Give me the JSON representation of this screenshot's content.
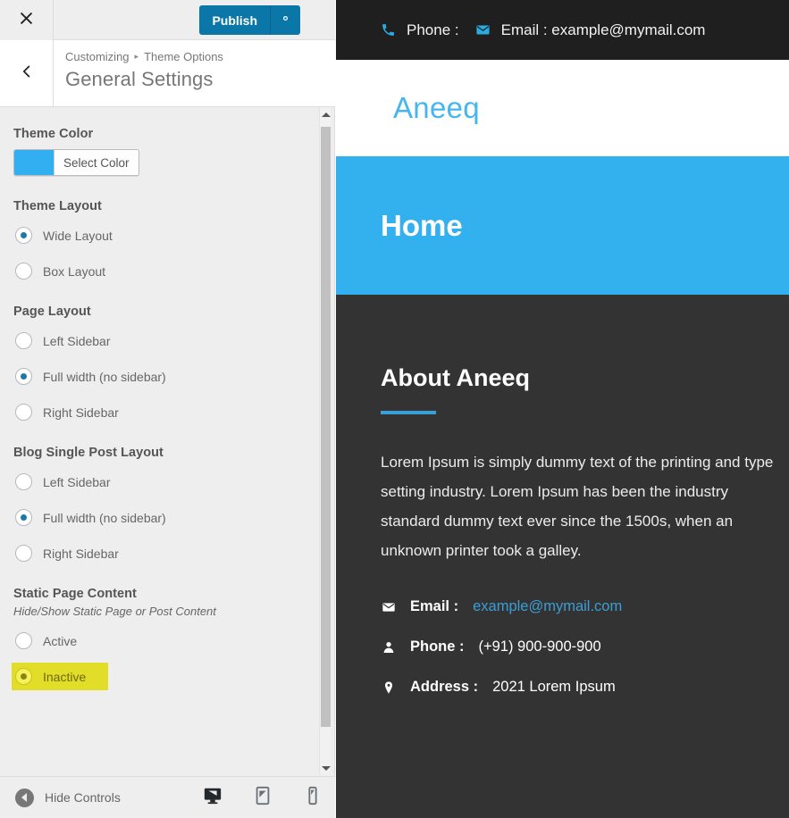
{
  "customizer": {
    "close_icon": "close-icon",
    "publish_label": "Publish",
    "gear_icon": "gear-icon",
    "back_icon": "chevron-left-icon",
    "breadcrumb_root": "Customizing",
    "breadcrumb_sep": "▸",
    "breadcrumb_parent": "Theme Options",
    "panel_title": "General Settings",
    "fields": {
      "theme_color": {
        "label": "Theme Color",
        "swatch_hex": "#32affO",
        "button_label": "Select Color"
      },
      "theme_layout": {
        "label": "Theme Layout",
        "options": [
          {
            "label": "Wide Layout",
            "checked": true
          },
          {
            "label": "Box Layout",
            "checked": false
          }
        ]
      },
      "page_layout": {
        "label": "Page Layout",
        "options": [
          {
            "label": "Left Sidebar",
            "checked": false
          },
          {
            "label": "Full width (no sidebar)",
            "checked": true
          },
          {
            "label": "Right Sidebar",
            "checked": false
          }
        ]
      },
      "blog_single_post_layout": {
        "label": "Blog Single Post Layout",
        "options": [
          {
            "label": "Left Sidebar",
            "checked": false
          },
          {
            "label": "Full width (no sidebar)",
            "checked": true
          },
          {
            "label": "Right Sidebar",
            "checked": false
          }
        ]
      },
      "static_page_content": {
        "label": "Static Page Content",
        "description": "Hide/Show Static Page or Post Content",
        "options": [
          {
            "label": "Active",
            "checked": false,
            "highlighted": false
          },
          {
            "label": "Inactive",
            "checked": true,
            "highlighted": true
          }
        ],
        "highlight_hex": "#e2dd28"
      }
    },
    "footer": {
      "hide_controls_label": "Hide Controls",
      "devices": [
        {
          "name": "desktop",
          "active": true
        },
        {
          "name": "tablet",
          "active": false
        },
        {
          "name": "mobile",
          "active": false
        }
      ]
    }
  },
  "preview": {
    "topbar": {
      "phone_icon": "phone-icon",
      "phone_label": "Phone :",
      "phone_value": "",
      "email_icon": "envelope-icon",
      "email_label": "Email : example@mymail.com"
    },
    "site_title": "Aneeq",
    "banner_title": "Home",
    "about": {
      "heading": "About Aneeq",
      "paragraph": "Lorem Ipsum is simply dummy text of the printing and type setting industry. Lorem Ipsum has been the industry standard dummy text ever since the 1500s, when an unknown printer took a galley.",
      "contacts": [
        {
          "icon": "envelope-icon",
          "key": "Email :",
          "value": "example@mymail.com",
          "is_link": true
        },
        {
          "icon": "user-icon",
          "key": "Phone :",
          "value": "(+91) 900-900-900",
          "is_link": false
        },
        {
          "icon": "map-pin-icon",
          "key": "Address :",
          "value": "2021 Lorem Ipsum",
          "is_link": false
        }
      ]
    },
    "accent_hex": "#33b1ef",
    "dark_hex": "#333333"
  }
}
